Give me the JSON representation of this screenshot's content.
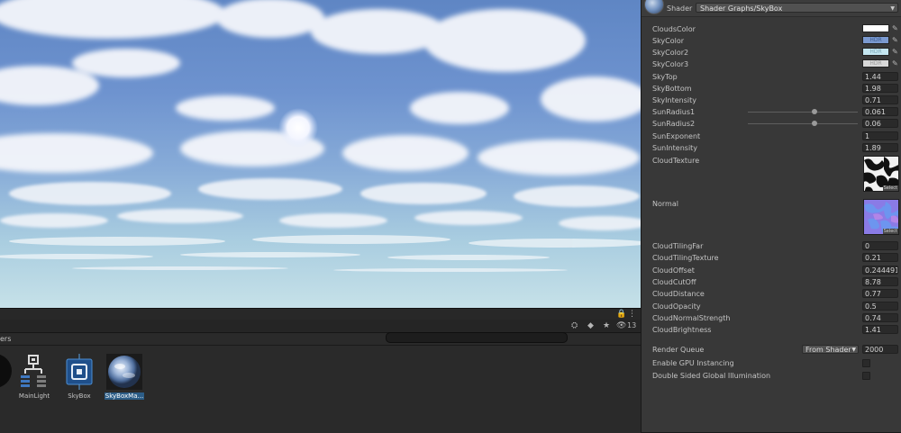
{
  "inspector": {
    "shader_label": "Shader",
    "shader_value": "Shader Graphs/SkyBox",
    "properties": {
      "clouds_color": {
        "label": "CloudsColor",
        "color": "#ffffff"
      },
      "sky_color": {
        "label": "SkyColor",
        "color": "#7b9ad0",
        "badge": "HDR"
      },
      "sky_color2": {
        "label": "SkyColor2",
        "color": "#c4e6f0",
        "badge": "HDR"
      },
      "sky_color3": {
        "label": "SkyColor3",
        "color": "#d8d8d8",
        "badge": "HDR"
      },
      "sky_top": {
        "label": "SkyTop",
        "value": "1.44"
      },
      "sky_bottom": {
        "label": "SkyBottom",
        "value": "1.98"
      },
      "sky_intensity": {
        "label": "SkyIntensity",
        "value": "0.71"
      },
      "sun_radius1": {
        "label": "SunRadius1",
        "value": "0.061"
      },
      "sun_radius2": {
        "label": "SunRadius2",
        "value": "0.06"
      },
      "sun_exponent": {
        "label": "SunExponent",
        "value": "1"
      },
      "sun_intensity": {
        "label": "SunIntensity",
        "value": "1.89"
      },
      "cloud_texture": {
        "label": "CloudTexture",
        "select_label": "Select"
      },
      "normal": {
        "label": "Normal",
        "select_label": "Select"
      },
      "cloud_tiling_far": {
        "label": "CloudTilingFar",
        "value": "0"
      },
      "cloud_tiling_texture": {
        "label": "CloudTilingTexture",
        "value": "0.21"
      },
      "cloud_offset": {
        "label": "CloudOffset",
        "value": "0.244491"
      },
      "cloud_cutoff": {
        "label": "CloudCutOff",
        "value": "8.78"
      },
      "cloud_distance": {
        "label": "CloudDistance",
        "value": "0.77"
      },
      "cloud_opacity": {
        "label": "CloudOpacity",
        "value": "0.5"
      },
      "cloud_normal_strength": {
        "label": "CloudNormalStrength",
        "value": "0.74"
      },
      "cloud_brightness": {
        "label": "CloudBrightness",
        "value": "1.41"
      }
    },
    "render_queue": {
      "label": "Render Queue",
      "mode": "From Shader",
      "value": "2000"
    },
    "gpu_instancing": {
      "label": "Enable GPU Instancing"
    },
    "double_sided_gi": {
      "label": "Double Sided Global Illumination"
    }
  },
  "project": {
    "breadcrumb": "ers",
    "visible_count": "13",
    "assets": [
      {
        "name": "MainLight",
        "icon": "light-prefab-icon",
        "selected": false
      },
      {
        "name": "SkyBox",
        "icon": "shader-graph-icon",
        "selected": false
      },
      {
        "name": "SkyBoxMa...",
        "icon": "material-sphere-icon",
        "selected": true
      }
    ]
  },
  "colors": {
    "accent": "#2c5d87",
    "inspector_bg": "#383838",
    "panel_bg": "#2a2a2a"
  }
}
